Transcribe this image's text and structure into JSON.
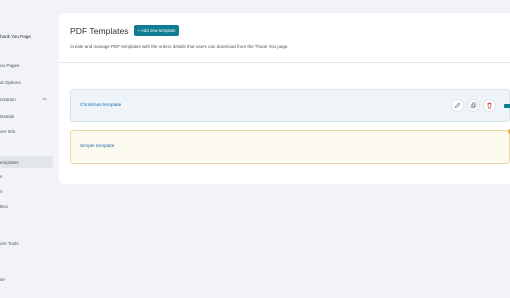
{
  "sidebar": {
    "items": [
      {
        "label": "hank You Page"
      },
      {
        "label": "ou Pages"
      },
      {
        "label": "al Options"
      },
      {
        "label": "nization"
      },
      {
        "label": "Details"
      },
      {
        "label": "ver Info"
      },
      {
        "label": "emplates"
      },
      {
        "label": "s"
      },
      {
        "label": "n"
      },
      {
        "label": "Box"
      },
      {
        "label": "ore Tools"
      },
      {
        "label": "se"
      }
    ]
  },
  "main": {
    "title": "PDF Templates",
    "add_button": "+ Add new template",
    "description": "Create and manage PDF templates with the orders details that users can download from the Thank You page.",
    "templates": [
      {
        "name": "Christmas template"
      },
      {
        "name": "Simple template"
      }
    ]
  },
  "colors": {
    "accent": "#0f7c92",
    "link": "#2271b1",
    "delete": "#d63638",
    "warning": "#e8a33d"
  }
}
